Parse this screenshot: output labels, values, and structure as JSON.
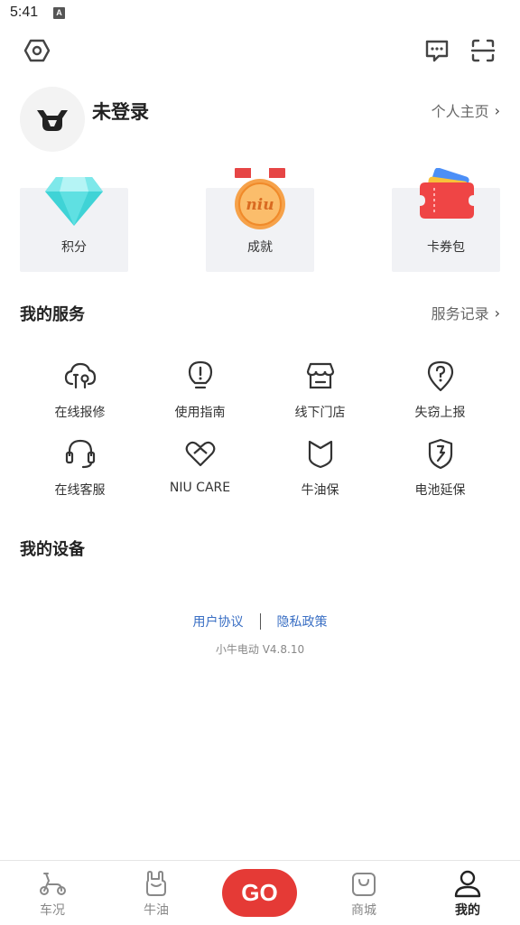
{
  "status": {
    "time": "5:41",
    "indicator": "A"
  },
  "header": {
    "settings_icon": "hexagon-settings-icon",
    "message_icon": "chat-bubble-icon",
    "scan_icon": "scan-icon"
  },
  "profile": {
    "username": "未登录",
    "homepage_link": "个人主页"
  },
  "cards": [
    {
      "label": "积分",
      "icon": "diamond-icon"
    },
    {
      "label": "成就",
      "icon": "medal-icon",
      "medal_text": "niu"
    },
    {
      "label": "卡券包",
      "icon": "wallet-icon"
    }
  ],
  "services": {
    "title": "我的服务",
    "link": "服务记录",
    "items": [
      {
        "label": "在线报修",
        "icon": "cloud-repair-icon"
      },
      {
        "label": "使用指南",
        "icon": "lightbulb-icon"
      },
      {
        "label": "线下门店",
        "icon": "store-icon"
      },
      {
        "label": "失窃上报",
        "icon": "location-question-icon"
      },
      {
        "label": "在线客服",
        "icon": "headset-icon"
      },
      {
        "label": "NIU CARE",
        "icon": "heart-care-icon"
      },
      {
        "label": "牛油保",
        "icon": "shield-niu-icon"
      },
      {
        "label": "电池延保",
        "icon": "battery-shield-icon"
      }
    ]
  },
  "devices": {
    "title": "我的设备"
  },
  "footer": {
    "user_agreement": "用户协议",
    "privacy_policy": "隐私政策",
    "version": "小牛电动 V4.8.10"
  },
  "bottom_nav": {
    "items": [
      {
        "label": "车况",
        "icon": "scooter-icon"
      },
      {
        "label": "牛油",
        "icon": "niu-hand-icon"
      },
      {
        "label": "商城",
        "icon": "shopping-bag-icon"
      },
      {
        "label": "我的",
        "icon": "person-icon",
        "active": true
      }
    ],
    "go_label": "GO"
  },
  "colors": {
    "accent": "#e53a36",
    "link": "#3a6fc4",
    "card_bg": "#f1f2f5"
  }
}
